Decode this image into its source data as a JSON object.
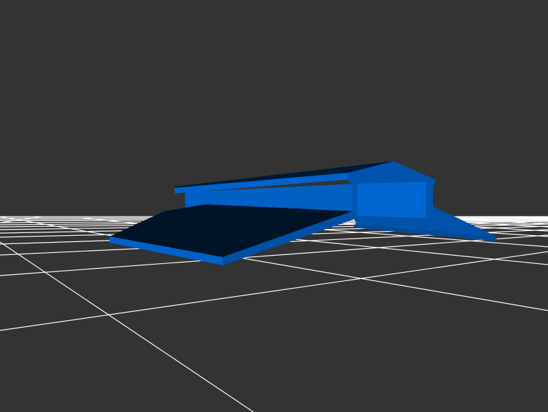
{
  "viewer": {
    "background_color": "#333333",
    "grid_color": "#ffffff",
    "model": {
      "primary_color": "#0060c8",
      "shadow_color": "#001428",
      "mid_color": "#0050a8",
      "dark_color": "#004a98"
    }
  }
}
